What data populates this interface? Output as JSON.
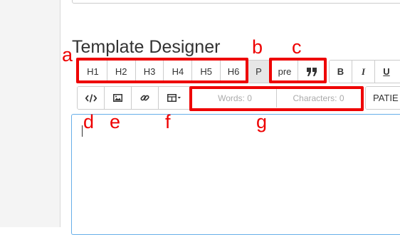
{
  "page": {
    "title": "Template Designer"
  },
  "toolbar": {
    "headings": [
      "H1",
      "H2",
      "H3",
      "H4",
      "H5",
      "H6"
    ],
    "paragraph": "P",
    "pre": "pre",
    "blockquote_icon": "quote-icon",
    "format": [
      {
        "label": "B",
        "icon": "bold-icon"
      },
      {
        "label": "I",
        "icon": "italic-icon"
      },
      {
        "label": "U",
        "icon": "underline-icon"
      }
    ],
    "insert": [
      {
        "icon": "code-icon"
      },
      {
        "icon": "image-icon"
      },
      {
        "icon": "link-icon"
      },
      {
        "icon": "table-icon"
      }
    ],
    "words": "Words: 0",
    "characters": "Characters: 0",
    "patient": "PATIE"
  },
  "annotations": {
    "a": "a",
    "b": "b",
    "c": "c",
    "d": "d",
    "e": "e",
    "f": "f",
    "g": "g",
    "color": "#ee0000"
  },
  "editor": {
    "content": ""
  },
  "colors": {
    "border": "#cccccc",
    "active_button": "#e6e6e6",
    "editor_focus_border": "#66afe9",
    "muted_text": "#aaaaaa"
  }
}
